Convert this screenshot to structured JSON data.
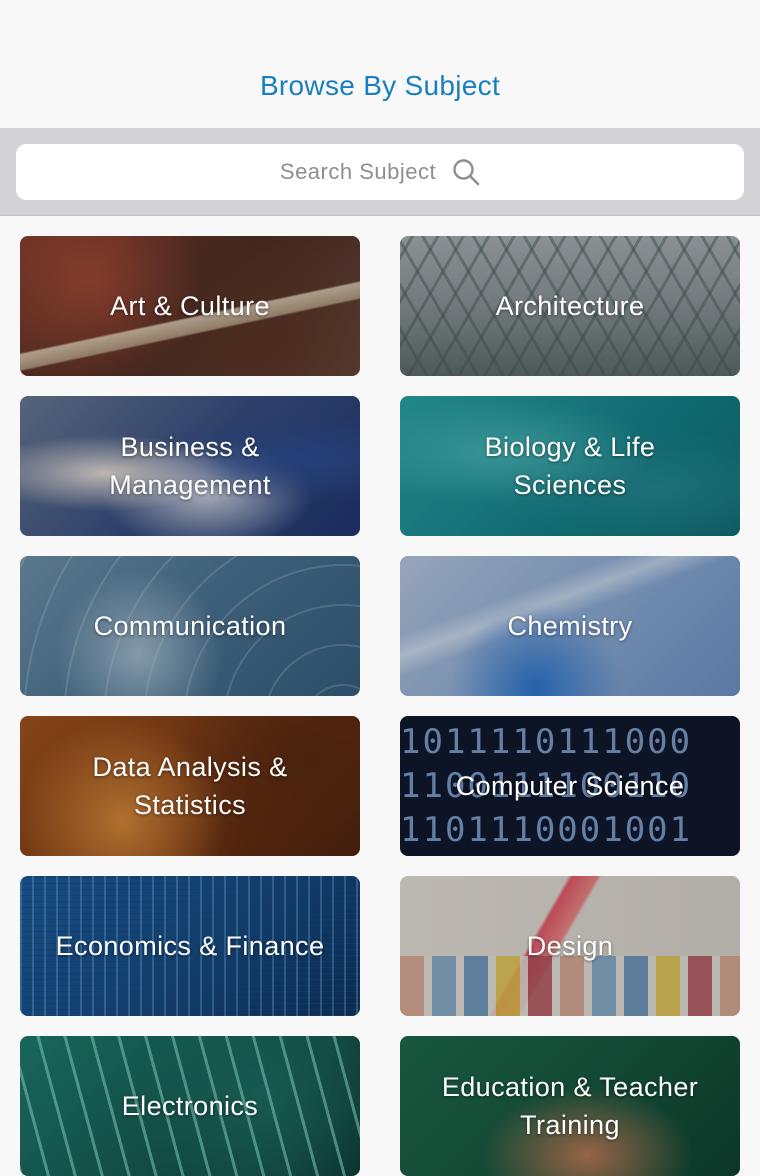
{
  "header": {
    "title": "Browse By Subject"
  },
  "search": {
    "placeholder": "Search Subject",
    "icon": "search-icon"
  },
  "subjects": [
    {
      "label": "Art & Culture"
    },
    {
      "label": "Architecture"
    },
    {
      "label": "Business &\nManagement"
    },
    {
      "label": "Biology & Life\nSciences"
    },
    {
      "label": "Communication"
    },
    {
      "label": "Chemistry"
    },
    {
      "label": "Data Analysis &\nStatistics"
    },
    {
      "label": "Computer Science"
    },
    {
      "label": "Economics & Finance"
    },
    {
      "label": "Design"
    },
    {
      "label": "Electronics"
    },
    {
      "label": "Education & Teacher\nTraining"
    }
  ],
  "colors": {
    "accent": "#1a7fbf",
    "placeholder": "#8e8e93"
  }
}
